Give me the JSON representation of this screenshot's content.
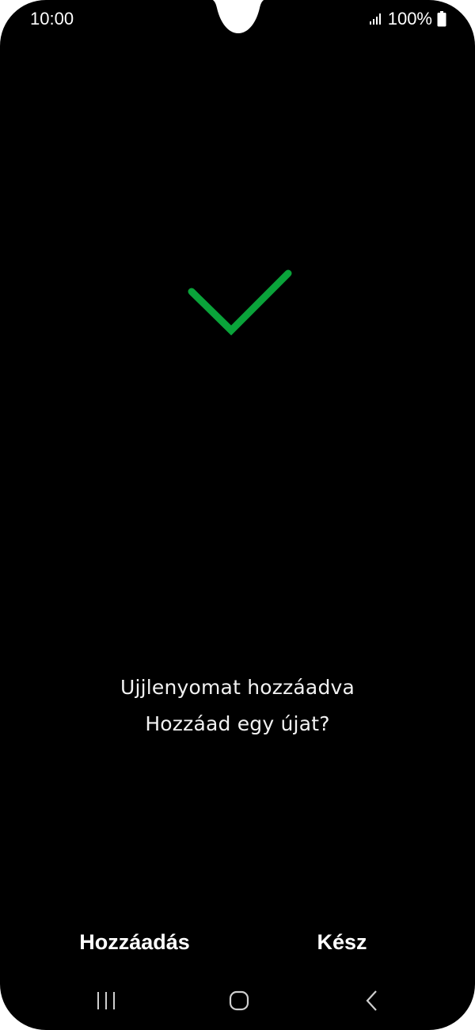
{
  "status_bar": {
    "time": "10:00",
    "battery_percent": "100%",
    "signal_icon": "cell-signal-icon",
    "battery_icon": "battery-full-icon"
  },
  "success_icon": {
    "name": "checkmark-icon",
    "color": "#0aa33a"
  },
  "message": {
    "line1": "Ujjlenyomat hozzáadva",
    "line2": "Hozzáad egy újat?"
  },
  "actions": {
    "add_label": "Hozzáadás",
    "done_label": "Kész"
  },
  "nav_bar": {
    "recents_icon": "recent-apps-icon",
    "home_icon": "home-icon",
    "back_icon": "back-icon"
  },
  "colors": {
    "background": "#000000",
    "text": "#ffffff",
    "accent": "#0aa33a"
  }
}
